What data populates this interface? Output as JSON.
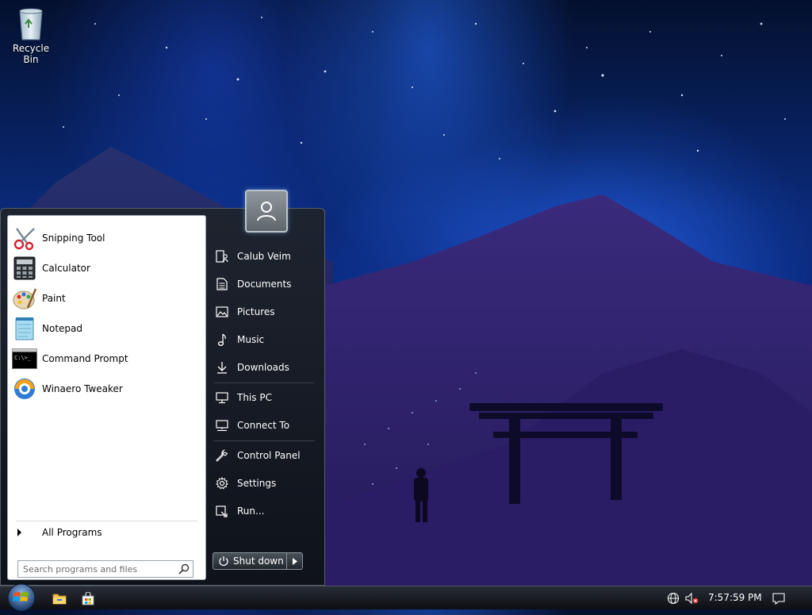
{
  "desktop": {
    "icons": [
      {
        "label": "Recycle Bin",
        "icon": "recycle-bin-icon"
      }
    ]
  },
  "start_menu": {
    "programs": [
      {
        "label": "Snipping Tool",
        "icon": "snipping-tool-icon"
      },
      {
        "label": "Calculator",
        "icon": "calculator-icon"
      },
      {
        "label": "Paint",
        "icon": "paint-icon"
      },
      {
        "label": "Notepad",
        "icon": "notepad-icon"
      },
      {
        "label": "Command Prompt",
        "icon": "command-prompt-icon"
      },
      {
        "label": "Winaero Tweaker",
        "icon": "winaero-tweaker-icon"
      }
    ],
    "all_programs_label": "All Programs",
    "search_placeholder": "Search programs and files",
    "right_items": [
      {
        "label": "Calub Veim",
        "icon": "user-folder-icon"
      },
      {
        "label": "Documents",
        "icon": "document-icon"
      },
      {
        "label": "Pictures",
        "icon": "picture-icon"
      },
      {
        "label": "Music",
        "icon": "music-note-icon"
      },
      {
        "label": "Downloads",
        "icon": "download-arrow-icon"
      },
      {
        "label": "This PC",
        "icon": "computer-icon"
      },
      {
        "label": "Connect To",
        "icon": "network-monitor-icon"
      },
      {
        "label": "Control Panel",
        "icon": "wrench-icon"
      },
      {
        "label": "Settings",
        "icon": "gear-icon"
      },
      {
        "label": "Run...",
        "icon": "run-icon"
      }
    ],
    "shutdown_label": "Shut down"
  },
  "taskbar": {
    "pinned": [
      {
        "icon": "file-explorer-icon"
      },
      {
        "icon": "store-bag-icon"
      }
    ],
    "tray": [
      {
        "icon": "network-globe-icon"
      },
      {
        "icon": "speaker-muted-icon"
      }
    ],
    "clock": "7:57:59 PM",
    "notification_icon": "action-center-icon"
  },
  "colors": {
    "accent_blue": "#1a5cff",
    "menu_dark": "#161b22",
    "taskbar": "#14171c"
  }
}
